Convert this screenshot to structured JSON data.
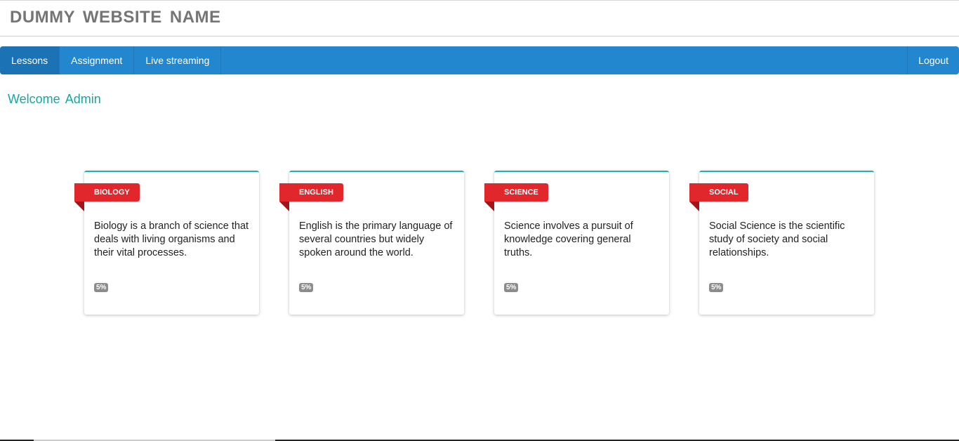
{
  "header": {
    "site_title": "DUMMY WEBSITE NAME"
  },
  "nav": {
    "items": [
      {
        "label": "Lessons",
        "active": true
      },
      {
        "label": "Assignment",
        "active": false
      },
      {
        "label": "Live streaming",
        "active": false
      }
    ],
    "logout_label": "Logout"
  },
  "welcome": {
    "text": "Welcome Admin"
  },
  "courses": [
    {
      "tag": "BIOLOGY",
      "description": "Biology is a branch of science that deals with living organisms and their vital processes.",
      "progress": "5%"
    },
    {
      "tag": "ENGLISH",
      "description": "English is the primary language of several countries but widely spoken around the world.",
      "progress": "5%"
    },
    {
      "tag": "SCIENCE",
      "description": "Science involves a pursuit of knowledge covering general truths.",
      "progress": "5%"
    },
    {
      "tag": "SOCIAL",
      "description": "Social Science is the scientific study of society and social relationships.",
      "progress": "5%"
    }
  ],
  "colors": {
    "nav_bg": "#2387d0",
    "welcome": "#1aa59e",
    "ribbon": "#e1262c",
    "card_top_border": "#1fb0b0"
  }
}
